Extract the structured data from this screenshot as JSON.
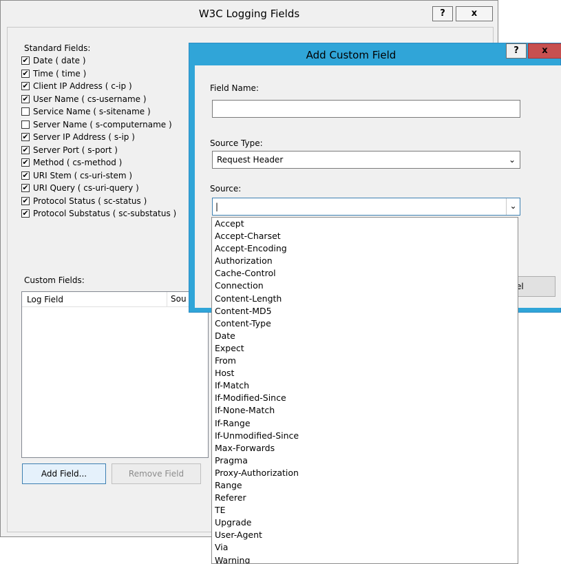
{
  "w3c_dialog": {
    "title": "W3C Logging Fields",
    "help_button": "?",
    "close_button": "x",
    "standard_fields_label": "Standard Fields:",
    "standard_fields": [
      {
        "label": "Date ( date )",
        "checked": true
      },
      {
        "label": "Time ( time )",
        "checked": true
      },
      {
        "label": "Client IP Address ( c-ip )",
        "checked": true
      },
      {
        "label": "User Name ( cs-username )",
        "checked": true
      },
      {
        "label": "Service Name ( s-sitename )",
        "checked": false
      },
      {
        "label": "Server Name ( s-computername )",
        "checked": false
      },
      {
        "label": "Server IP Address ( s-ip )",
        "checked": true
      },
      {
        "label": "Server Port ( s-port )",
        "checked": true
      },
      {
        "label": "Method ( cs-method )",
        "checked": true
      },
      {
        "label": "URI Stem ( cs-uri-stem )",
        "checked": true
      },
      {
        "label": "URI Query ( cs-uri-query )",
        "checked": true
      },
      {
        "label": "Protocol Status ( sc-status )",
        "checked": true
      },
      {
        "label": "Protocol Substatus ( sc-substatus )",
        "checked": true
      }
    ],
    "custom_fields_label": "Custom Fields:",
    "custom_columns": [
      "Log Field",
      "Sou"
    ],
    "add_field_button": "Add Field...",
    "remove_field_button": "Remove Field"
  },
  "add_custom_field": {
    "title": "Add Custom Field",
    "help_button": "?",
    "close_button": "x",
    "field_name_label": "Field Name:",
    "field_name_value": "",
    "source_type_label": "Source Type:",
    "source_type_value": "Request Header",
    "source_label": "Source:",
    "source_value": "",
    "cancel_partial": "el"
  },
  "source_options": [
    "Accept",
    "Accept-Charset",
    "Accept-Encoding",
    "Authorization",
    "Cache-Control",
    "Connection",
    "Content-Length",
    "Content-MD5",
    "Content-Type",
    "Date",
    "Expect",
    "From",
    "Host",
    "If-Match",
    "If-Modified-Since",
    "If-None-Match",
    "If-Range",
    "If-Unmodified-Since",
    "Max-Forwards",
    "Pragma",
    "Proxy-Authorization",
    "Range",
    "Referer",
    "TE",
    "Upgrade",
    "User-Agent",
    "Via",
    "Warning"
  ]
}
